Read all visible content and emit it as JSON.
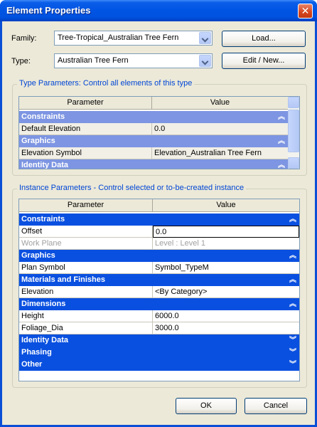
{
  "window": {
    "title": "Element Properties",
    "close_glyph": "✕"
  },
  "family": {
    "label": "Family:",
    "value": "Tree-Tropical_Australian Tree Fern"
  },
  "type": {
    "label": "Type:",
    "value": "Australian Tree Fern"
  },
  "buttons": {
    "load": "Load...",
    "edit_new": "Edit / New...",
    "ok": "OK",
    "cancel": "Cancel"
  },
  "type_params": {
    "title": "Type Parameters: Control all elements of this type",
    "headers": {
      "param": "Parameter",
      "value": "Value"
    },
    "sections": [
      {
        "name": "Constraints",
        "rows": [
          {
            "param": "Default Elevation",
            "value": "0.0"
          }
        ]
      },
      {
        "name": "Graphics",
        "rows": [
          {
            "param": "Elevation Symbol",
            "value": "Elevation_Australian Tree Fern"
          }
        ]
      },
      {
        "name": "Identity Data",
        "rows": []
      }
    ]
  },
  "instance_params": {
    "title": "Instance Parameters - Control selected or to-be-created instance",
    "headers": {
      "param": "Parameter",
      "value": "Value"
    },
    "sections": [
      {
        "name": "Constraints",
        "rows": [
          {
            "param": "Offset",
            "value": "0.0"
          },
          {
            "param": "Work Plane",
            "value": "Level : Level 1"
          }
        ]
      },
      {
        "name": "Graphics",
        "rows": [
          {
            "param": "Plan Symbol",
            "value": "Symbol_TypeM"
          }
        ]
      },
      {
        "name": "Materials and Finishes",
        "rows": [
          {
            "param": "Elevation",
            "value": "<By Category>"
          }
        ]
      },
      {
        "name": "Dimensions",
        "rows": [
          {
            "param": "Height",
            "value": "6000.0"
          },
          {
            "param": "Foliage_Dia",
            "value": "3000.0"
          }
        ]
      },
      {
        "name": "Identity Data",
        "rows": []
      },
      {
        "name": "Phasing",
        "rows": []
      },
      {
        "name": "Other",
        "rows": []
      }
    ]
  },
  "colors": {
    "section_blue": "#0a50e0",
    "type_section_blue": "#7d95e2",
    "window_border": "#0a4fd6"
  },
  "icons": {
    "collapse": "chevron-up-double",
    "expand": "chevron-down-double"
  }
}
